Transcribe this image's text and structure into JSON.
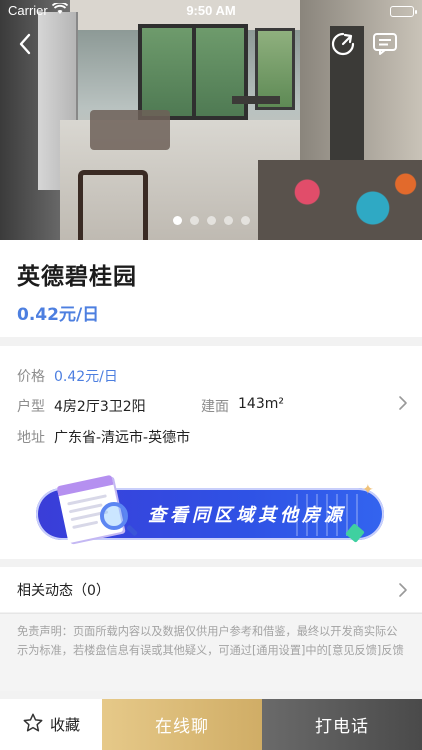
{
  "status_bar": {
    "carrier": "Carrier",
    "time": "9:50 AM"
  },
  "gallery": {
    "total_images": 5,
    "active_index": 0
  },
  "property": {
    "title": "英德碧桂园",
    "price_headline": "0.42元/日"
  },
  "info": {
    "price_label": "价格",
    "price_value": "0.42元/日",
    "layout_label": "户型",
    "layout_value": "4房2厅3卫2阳",
    "area_label": "建面",
    "area_value": "143m²",
    "address_label": "地址",
    "address_value": "广东省-清远市-英德市"
  },
  "banner": {
    "text": "查看同区域其他房源"
  },
  "news": {
    "label": "相关动态（0）"
  },
  "disclaimer": "免责声明：页面所载内容以及数据仅供用户参考和借鉴，最终以开发商实际公示为标准，若楼盘信息有误或其他疑义，可通过[通用设置]中的[意见反馈]反馈",
  "bottom_bar": {
    "favorite_label": "收藏",
    "chat_label": "在线聊",
    "call_label": "打电话"
  },
  "colors": {
    "accent_blue": "#4d7fe0",
    "chat_gold": "#d9b774",
    "call_gray": "#5a5a5a"
  },
  "icons": [
    "back-icon",
    "share-icon",
    "message-icon",
    "chevron-right-icon",
    "star-icon",
    "wifi-icon",
    "battery-icon"
  ]
}
